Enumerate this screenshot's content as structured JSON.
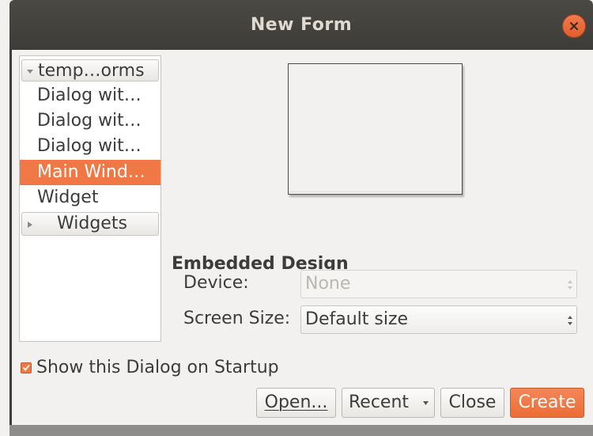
{
  "window": {
    "title": "New Form"
  },
  "tree": {
    "header": "temp…orms",
    "items": [
      {
        "label": "Dialog wit…"
      },
      {
        "label": "Dialog wit…"
      },
      {
        "label": "Dialog wit…"
      },
      {
        "label": "Main Wind…",
        "selected": true
      },
      {
        "label": "Widget"
      }
    ],
    "group": "Widgets"
  },
  "embedded": {
    "title": "Embedded Design",
    "device_label": "Device:",
    "device_value": "None",
    "screen_size_label": "Screen Size:",
    "screen_size_value": "Default size"
  },
  "startup": {
    "label": "Show this Dialog on Startup",
    "checked": true
  },
  "buttons": {
    "open": "Open...",
    "recent": "Recent",
    "close": "Close",
    "create": "Create"
  },
  "colors": {
    "accent": "#f07746",
    "titlebar": "#3e3c38",
    "window_bg": "#f2f1f0"
  }
}
